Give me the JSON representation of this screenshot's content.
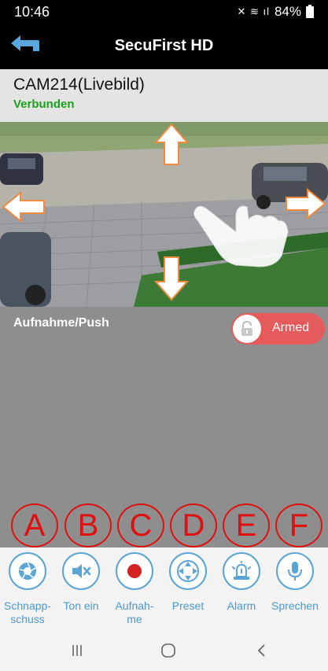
{
  "status_bar": {
    "time": "10:46",
    "battery": "84%"
  },
  "app_bar": {
    "title": "SecuFirst HD"
  },
  "camera": {
    "title": "CAM214(Livebild)",
    "status": "Verbunden"
  },
  "panel": {
    "label": "Aufnahme/Push",
    "armed_label": "Armed",
    "armed_state": true
  },
  "letters": [
    "A",
    "B",
    "C",
    "D",
    "E",
    "F"
  ],
  "toolbar": [
    {
      "label": "Schnapp-\nschuss",
      "icon": "camera-shutter-icon"
    },
    {
      "label": "Ton ein",
      "icon": "speaker-mute-icon"
    },
    {
      "label": "Aufnah-\nme",
      "icon": "record-icon"
    },
    {
      "label": "Preset",
      "icon": "dpad-icon"
    },
    {
      "label": "Alarm",
      "icon": "alarm-light-icon"
    },
    {
      "label": "Sprechen",
      "icon": "microphone-icon"
    }
  ],
  "colors": {
    "accent": "#4e98cf",
    "armed": "#e55a5a",
    "connected": "#1aa31a",
    "annotation": "#e01010"
  }
}
